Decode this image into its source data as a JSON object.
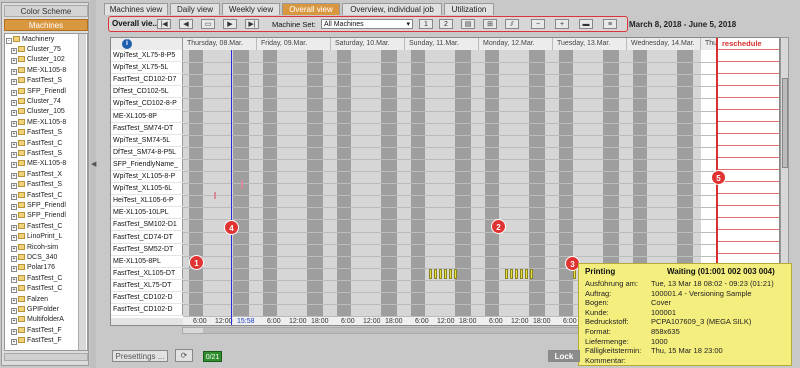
{
  "sidebar": {
    "tabs": [
      "Color Scheme",
      "Machines"
    ],
    "tree_root": "Machinery",
    "tree_items": [
      "Cluster_75",
      "Cluster_102",
      "ME-XL105-8",
      "FastTest_S",
      "SFP_Friendl",
      "Cluster_74",
      "Cluster_105",
      "ME-XL105-8",
      "FastTest_S",
      "FastTest_C",
      "FastTest_S",
      "ME-XL105-8",
      "FastTest_X",
      "FastTest_S",
      "FastTest_C",
      "SFP_Friendl",
      "SFP_Friendl",
      "FastTest_C",
      "LinoPrint_L",
      "Ricoh-sim",
      "DCS_340",
      "Polar176",
      "FastTest_C",
      "FastTest_C",
      "Falzen",
      "GPIFolder",
      "MultifolderA",
      "FastTest_F",
      "FastTest_F"
    ]
  },
  "tabs": [
    "Machines view",
    "Daily view",
    "Weekly view",
    "Overall view",
    "Overview, individual job",
    "Utilization"
  ],
  "active_tab": "Overall view",
  "toolbar": {
    "label": "Overall vie...",
    "machine_set_label": "Machine Set:",
    "machine_set_value": "All Machines",
    "btn_1": "1",
    "btn_2": "2",
    "date_range": "March 8, 2018  -  June 5, 2018"
  },
  "grid": {
    "info_icon": "info-icon",
    "days": [
      "Thursday, 08.Mar.",
      "Friday, 09.Mar.",
      "Saturday, 10.Mar.",
      "Sunday, 11.Mar.",
      "Monday, 12.Mar.",
      "Tuesday, 13.Mar.",
      "Wednesday, 14.Mar.",
      "Thur"
    ],
    "reschedule_label": "reschedule",
    "machines": [
      "WpiTest_XL75-8-P5",
      "WpiTest_XL75-5L",
      "FastTest_CD102-D7",
      "DfTest_CD102-5L",
      "WpiTest_CD102-8-P",
      "ME-XL105-8P",
      "FastTest_SM74-DT",
      "WpiTest_SM74-5L",
      "DfTest_SM74-8-P5L",
      "SFP_FriendlyName_",
      "WpiTest_XL105-8-P",
      "WpiTest_XL105-6L",
      "HeiTest_XL105-6-P",
      "ME-XL105-10LPL",
      "FastTest_SM102-D1",
      "FastTest_CD74-DT",
      "FastTest_SM52-DT",
      "ME-XL105-8PL",
      "FastTest_XL105-DT",
      "FastTest_XL75-DT",
      "FastTest_CD102-D",
      "FastTest_CD102-D",
      "FastTest_CD102-D"
    ],
    "time_labels": [
      "6:00",
      "12:00",
      "15:58",
      "6:00",
      "12:00",
      "18:00",
      "6:00",
      "12:00",
      "18:00",
      "6:00",
      "12:00",
      "18:00",
      "6:00",
      "12:00",
      "18:00",
      "6:00",
      "12:00",
      "18:00",
      "6:00",
      "12:00",
      "18:00"
    ]
  },
  "badges": [
    "1",
    "2",
    "3",
    "4",
    "5"
  ],
  "popup": {
    "title": "Printing",
    "status": "Waiting  (01:001 002 003 004)",
    "rows": [
      {
        "label": "Ausführung am:",
        "value": "Tue, 13 Mar 18   08:02 - 09:23  (01:21)"
      },
      {
        "label": "Auftrag:",
        "value": "100001.4 - Versioning Sample"
      },
      {
        "label": "Bogen:",
        "value": "Cover"
      },
      {
        "label": "Kunde:",
        "value": "100001"
      },
      {
        "label": "Bedruckstoff:",
        "value": "PCPA107609_3 (MEGA SILK)"
      },
      {
        "label": "Format:",
        "value": "858x635"
      },
      {
        "label": "Liefermenge:",
        "value": "1000"
      },
      {
        "label": "Fälligkeitstermin:",
        "value": "Thu, 15 Mar 18   23:00"
      },
      {
        "label": "Kommentar:",
        "value": ""
      }
    ]
  },
  "bottom": {
    "presettings": "Presettings ...",
    "counter": "0/21",
    "lock": "Lock"
  },
  "colors": {
    "accent": "#d99840",
    "badge": "#e03432",
    "job": "#e6df3c",
    "now_line": "#2a2adc",
    "reschedule": "#d83030"
  }
}
